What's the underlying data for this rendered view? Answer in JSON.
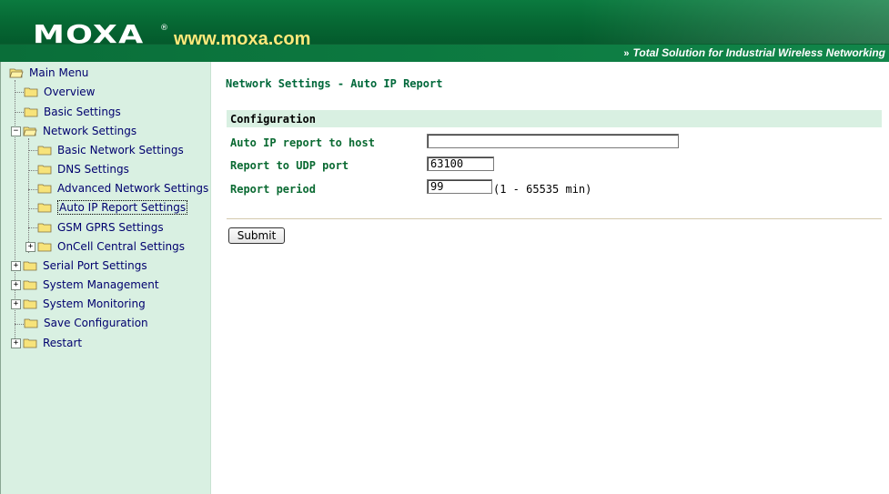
{
  "header": {
    "logo": "MOXA",
    "registered": "®",
    "website": "www.moxa.com",
    "tagline_chevrons": "»",
    "tagline": "Total Solution for Industrial Wireless Networking"
  },
  "sidebar": {
    "items": [
      {
        "label": "Main Menu",
        "icon": "open-folder-icon"
      },
      {
        "label": "Overview",
        "icon": "folder-icon"
      },
      {
        "label": "Basic Settings",
        "icon": "folder-icon"
      },
      {
        "label": "Network Settings",
        "icon": "open-folder-icon",
        "expander": "−"
      },
      {
        "label": "Basic Network Settings",
        "icon": "folder-icon"
      },
      {
        "label": "DNS Settings",
        "icon": "folder-icon"
      },
      {
        "label": "Advanced Network Settings",
        "icon": "folder-icon"
      },
      {
        "label": "Auto IP Report Settings",
        "icon": "folder-icon",
        "selected": true
      },
      {
        "label": "GSM GPRS Settings",
        "icon": "folder-icon"
      },
      {
        "label": "OnCell Central Settings",
        "icon": "folder-icon",
        "expander": "+"
      },
      {
        "label": "Serial Port Settings",
        "icon": "folder-icon",
        "expander": "+"
      },
      {
        "label": "System Management",
        "icon": "folder-icon",
        "expander": "+"
      },
      {
        "label": "System Monitoring",
        "icon": "folder-icon",
        "expander": "+"
      },
      {
        "label": "Save Configuration",
        "icon": "folder-icon"
      },
      {
        "label": "Restart",
        "icon": "folder-icon",
        "expander": "+"
      }
    ]
  },
  "main": {
    "title": "Network Settings - Auto IP Report",
    "section_title": "Configuration",
    "fields": {
      "host": {
        "label": "Auto IP report to host",
        "value": ""
      },
      "udp_port": {
        "label": "Report to UDP port",
        "value": "63100"
      },
      "period": {
        "label": "Report period",
        "value": "99",
        "hint": "(1 - 65535 min)"
      }
    },
    "submit_label": "Submit"
  },
  "colors": {
    "brand_green": "#066733",
    "sidebar_bg": "#d9f0e2",
    "title_green": "#00683a",
    "website_yellow": "#ffe97a"
  }
}
